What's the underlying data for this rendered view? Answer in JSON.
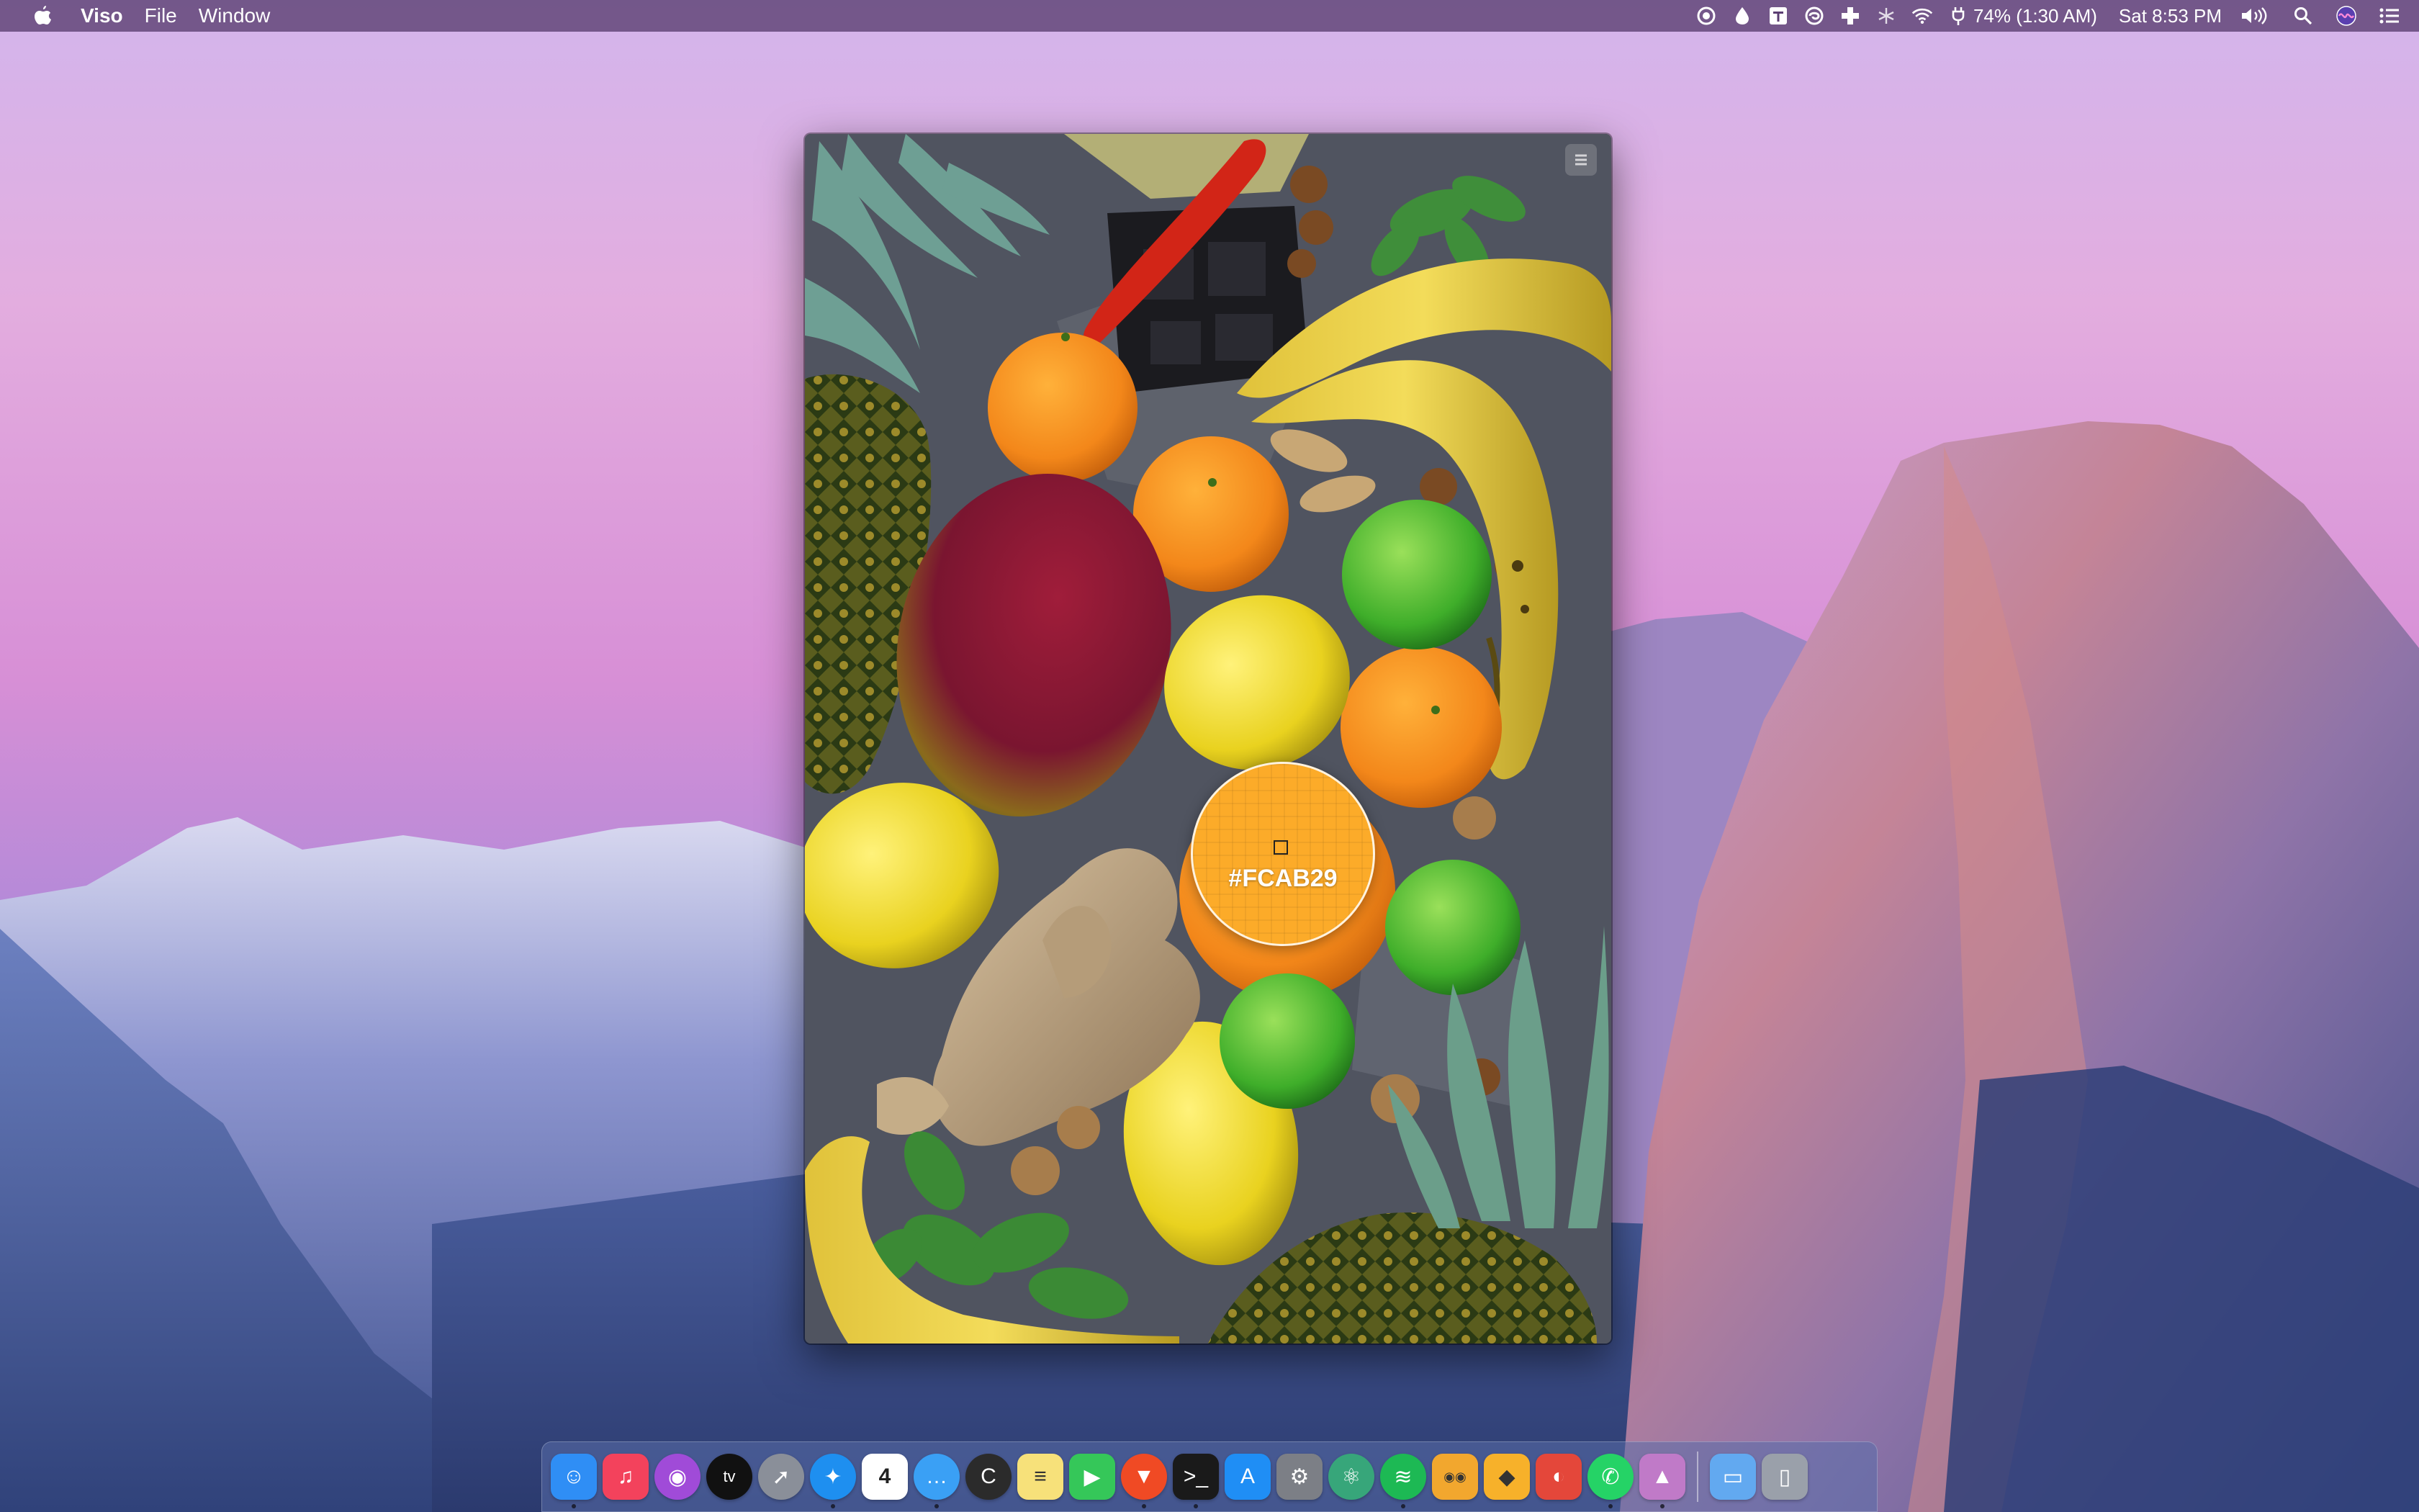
{
  "menubar": {
    "app_name": "Viso",
    "menus": [
      "File",
      "Window"
    ],
    "battery_text": "74% (1:30 AM)",
    "clock_text": "Sat 8:53 PM",
    "status_icons": [
      "record-icon",
      "drop-icon",
      "text-t-icon",
      "swirl-icon",
      "plus-cross-icon",
      "snowflake-icon",
      "wifi-icon",
      "power-plug-icon"
    ],
    "right_icons": [
      "volume-icon",
      "spotlight-search-icon",
      "siri-icon",
      "notification-center-icon"
    ]
  },
  "viso_window": {
    "picked_color_hex": "#FCAB29",
    "picked_color": "#fcab29",
    "content": "photo of fruits: pineapple, mango, oranges, lemons, limes, bananas, ginger, chili, nuts, mint"
  },
  "dock": {
    "apps": [
      {
        "name": "Finder",
        "icon": "finder-icon",
        "color": "#2f8ef5",
        "running": true
      },
      {
        "name": "Music",
        "icon": "music-icon",
        "color": "#f3425c",
        "running": false
      },
      {
        "name": "Podcasts",
        "icon": "podcasts-icon",
        "color": "#a04bd8",
        "running": false
      },
      {
        "name": "TV",
        "icon": "apple-tv-icon",
        "color": "#111111",
        "running": false
      },
      {
        "name": "Launchpad",
        "icon": "rocket-icon",
        "color": "#8a8f99",
        "running": false
      },
      {
        "name": "Safari",
        "icon": "safari-compass-icon",
        "color": "#1e8ff0",
        "running": true
      },
      {
        "name": "Calendar",
        "icon": "calendar-icon",
        "color": "#ffffff",
        "label": "4",
        "running": false
      },
      {
        "name": "Messages-like",
        "icon": "chat-bubble-icon",
        "color": "#3aa0f5",
        "running": true
      },
      {
        "name": "CotEditor",
        "icon": "c-letter-icon",
        "color": "#2b2b2b",
        "running": false
      },
      {
        "name": "Notes",
        "icon": "notes-icon",
        "color": "#f7e17a",
        "running": false
      },
      {
        "name": "FaceTime",
        "icon": "facetime-icon",
        "color": "#35c759",
        "running": false
      },
      {
        "name": "Brave",
        "icon": "brave-lion-icon",
        "color": "#f04a24",
        "running": true
      },
      {
        "name": "Terminal",
        "icon": "terminal-icon",
        "color": "#1a1a1a",
        "running": true
      },
      {
        "name": "App Store",
        "icon": "app-store-icon",
        "color": "#1f8ef5",
        "running": false
      },
      {
        "name": "System Preferences",
        "icon": "gear-icon",
        "color": "#7c7f86",
        "running": false
      },
      {
        "name": "Atom",
        "icon": "atom-icon",
        "color": "#37a67a",
        "running": false
      },
      {
        "name": "Spotify",
        "icon": "spotify-icon",
        "color": "#1db954",
        "running": true
      },
      {
        "name": "Paw",
        "icon": "glasses-face-icon",
        "color": "#f2a72e",
        "running": false
      },
      {
        "name": "Sketch",
        "icon": "sketch-diamond-icon",
        "color": "#f7b12a",
        "running": false
      },
      {
        "name": "Parrot",
        "icon": "parrot-icon",
        "color": "#e4473a",
        "running": false
      },
      {
        "name": "WhatsApp",
        "icon": "whatsapp-icon",
        "color": "#25d366",
        "running": true
      },
      {
        "name": "Viso",
        "icon": "viso-landscape-icon",
        "color": "#c07ac8",
        "running": true
      },
      {
        "name": "Downloads folder",
        "icon": "folder-icon",
        "color": "#62a9f0",
        "running": false
      },
      {
        "name": "Trash",
        "icon": "trash-icon",
        "color": "#9aa0aa",
        "running": false
      }
    ]
  }
}
